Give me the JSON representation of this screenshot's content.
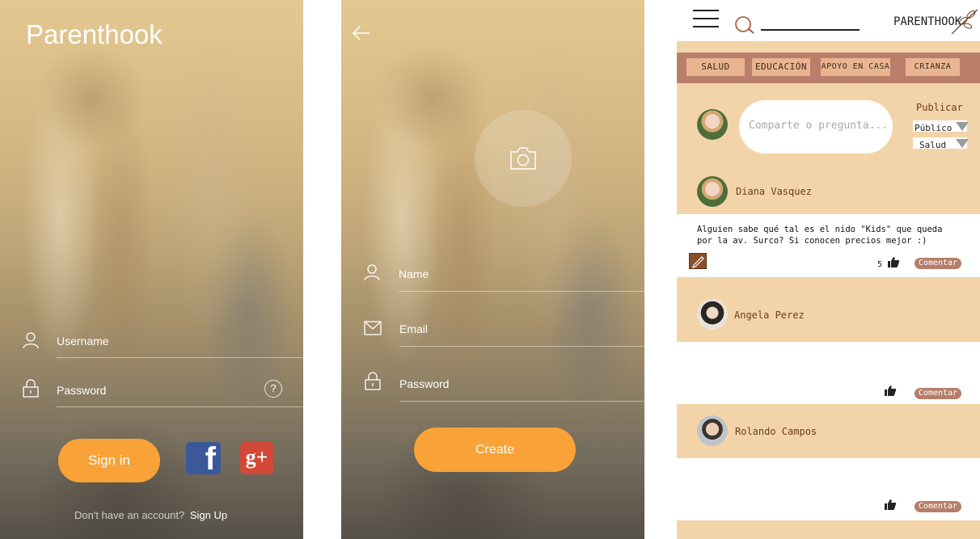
{
  "screen_login": {
    "app_title": "Parenthook",
    "username_label": "Username",
    "password_label": "Password",
    "help_icon": "?",
    "sign_in": "Sign in",
    "facebook": "f",
    "google": "g+",
    "no_account": "Don't have an account?",
    "sign_up": "Sign Up"
  },
  "screen_create": {
    "name_label": "Name",
    "email_label": "Email",
    "password_label": "Password",
    "create": "Create"
  },
  "screen_feed": {
    "logo": "PARENTHOOK",
    "categories": [
      "SALUD",
      "EDUCACIÓN",
      "APOYO EN CASA",
      "CRIANZA"
    ],
    "post_placeholder": "Comparte o pregunta...",
    "publish_label": "Publicar",
    "visibility": "Público",
    "category_select": "Salud",
    "posts": [
      {
        "user": "Diana Vasquez",
        "text": "Alguien sabe qué tal es el nido \"Kids\" que queda por la av. Surco? Si conocen precios mejor :)",
        "likes": "5",
        "comment": "Comentar"
      },
      {
        "user": "Angela Perez",
        "comment": "Comentar"
      },
      {
        "user": "Rolando Campos",
        "comment": "Comentar"
      }
    ]
  },
  "colors": {
    "accent": "#f8a237",
    "feed_band": "#f3d4a8",
    "category_bar": "#b97f6a",
    "comment_button": "#b67e6a"
  }
}
